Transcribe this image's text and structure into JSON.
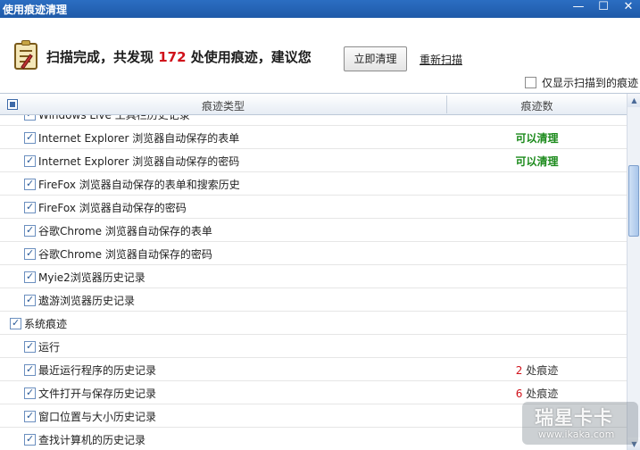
{
  "window": {
    "title": "使用痕迹清理",
    "min_label": "—",
    "max_label": "☐",
    "close_label": "✕"
  },
  "summary": {
    "prefix": "扫描完成，共发现 ",
    "count": "172",
    "suffix": " 处使用痕迹，建议您",
    "clean_button": "立即清理",
    "rescan_link": "重新扫描",
    "filter_label": "仅显示扫描到的痕迹"
  },
  "table": {
    "col_type": "痕迹类型",
    "col_count": "痕迹数",
    "rows": [
      {
        "label": "Windows Live 工具栏历史记录",
        "indent": 1,
        "status": "",
        "count": "",
        "unit": ""
      },
      {
        "label": "Internet Explorer 浏览器自动保存的表单",
        "indent": 1,
        "status": "可以清理",
        "count": "",
        "unit": ""
      },
      {
        "label": "Internet Explorer 浏览器自动保存的密码",
        "indent": 1,
        "status": "可以清理",
        "count": "",
        "unit": ""
      },
      {
        "label": "FireFox 浏览器自动保存的表单和搜索历史",
        "indent": 1,
        "status": "",
        "count": "",
        "unit": ""
      },
      {
        "label": "FireFox 浏览器自动保存的密码",
        "indent": 1,
        "status": "",
        "count": "",
        "unit": ""
      },
      {
        "label": "谷歌Chrome 浏览器自动保存的表单",
        "indent": 1,
        "status": "",
        "count": "",
        "unit": ""
      },
      {
        "label": "谷歌Chrome 浏览器自动保存的密码",
        "indent": 1,
        "status": "",
        "count": "",
        "unit": ""
      },
      {
        "label": "Myie2浏览器历史记录",
        "indent": 1,
        "status": "",
        "count": "",
        "unit": ""
      },
      {
        "label": "遨游浏览器历史记录",
        "indent": 1,
        "status": "",
        "count": "",
        "unit": ""
      },
      {
        "label": "系统痕迹",
        "indent": 0,
        "status": "",
        "count": "",
        "unit": ""
      },
      {
        "label": "运行",
        "indent": 1,
        "status": "",
        "count": "",
        "unit": ""
      },
      {
        "label": "最近运行程序的历史记录",
        "indent": 1,
        "status": "",
        "count": "2",
        "unit": "处痕迹"
      },
      {
        "label": "文件打开与保存历史记录",
        "indent": 1,
        "status": "",
        "count": "6",
        "unit": "处痕迹"
      },
      {
        "label": "窗口位置与大小历史记录",
        "indent": 1,
        "status": "",
        "count": "",
        "unit": ""
      },
      {
        "label": "查找计算机的历史记录",
        "indent": 1,
        "status": "",
        "count": "",
        "unit": ""
      }
    ]
  },
  "watermark": {
    "brand": "瑞星卡卡",
    "url": "www.ikaka.com"
  },
  "colors": {
    "titlebar": "#1f5aa8",
    "count_red": "#d0121b",
    "status_green": "#1b8a1b"
  }
}
